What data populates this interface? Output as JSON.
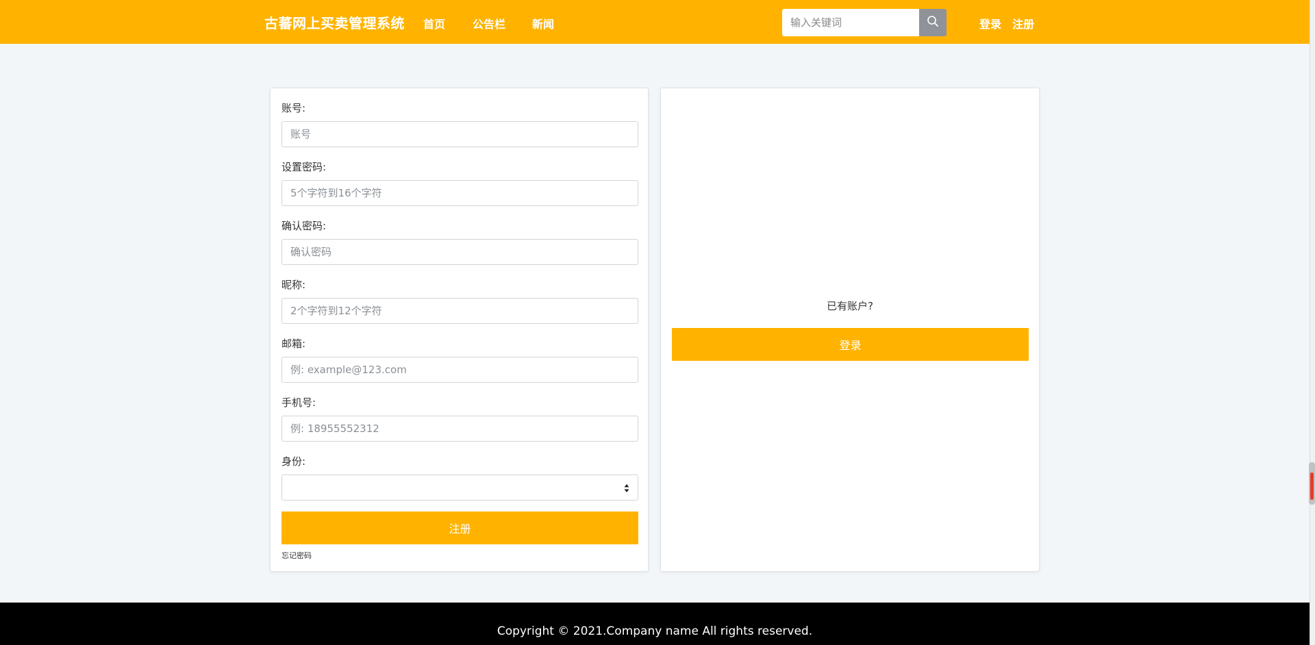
{
  "header": {
    "brand": "古蕃网上买卖管理系统",
    "nav": [
      "首页",
      "公告栏",
      "新闻"
    ],
    "search_placeholder": "输入关键词",
    "login": "登录",
    "register": "注册"
  },
  "form": {
    "fields": [
      {
        "label": "账号:",
        "placeholder": "账号"
      },
      {
        "label": "设置密码:",
        "placeholder": "5个字符到16个字符"
      },
      {
        "label": "确认密码:",
        "placeholder": "确认密码"
      },
      {
        "label": "昵称:",
        "placeholder": "2个字符到12个字符"
      },
      {
        "label": "邮箱:",
        "placeholder": "例: example@123.com"
      },
      {
        "label": "手机号:",
        "placeholder": "例: 18955552312"
      }
    ],
    "identity_label": "身份:",
    "identity_value": "",
    "submit": "注册",
    "forgot": "忘记密码"
  },
  "aside": {
    "prompt": "已有账户?",
    "login_button": "登录"
  },
  "footer": {
    "copyright": "Copyright © 2021.Company name All rights reserved."
  },
  "colors": {
    "accent": "#ffb300",
    "footer_bg": "#000000",
    "page_bg": "#f3f6f9"
  }
}
